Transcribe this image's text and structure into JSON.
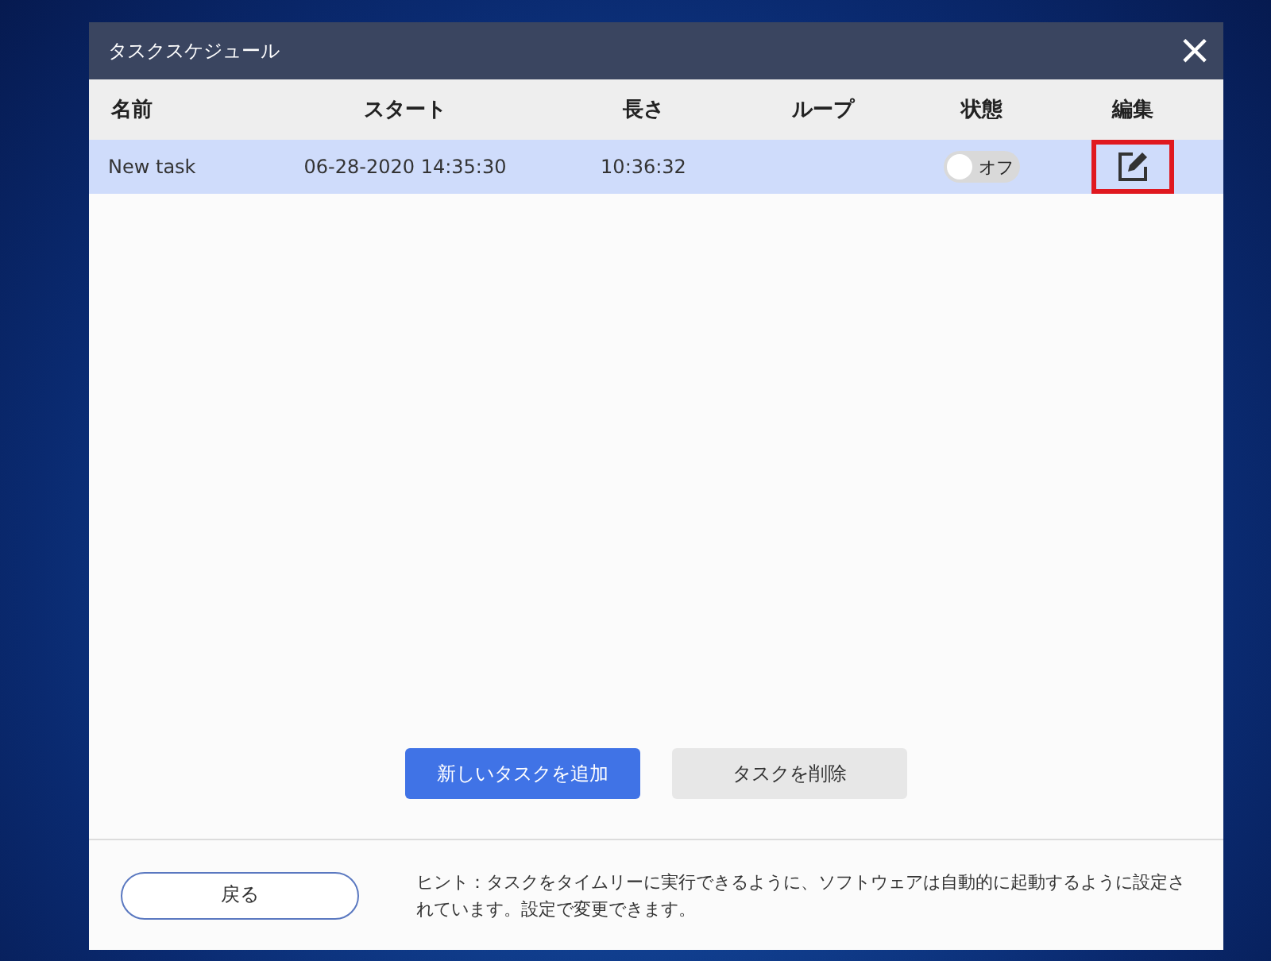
{
  "window": {
    "title": "タスクスケジュール",
    "close_glyph": "×"
  },
  "table": {
    "columns": [
      "名前",
      "スタート",
      "長さ",
      "ループ",
      "状態",
      "編集"
    ],
    "rows": [
      {
        "name": "New task",
        "start": "06-28-2020 14:35:30",
        "length": "10:36:32",
        "selected": true,
        "status": {
          "label": "オフ",
          "on": false
        },
        "edit_highlighted": true
      }
    ]
  },
  "actions": [
    {
      "label": "新しいタスクを追加",
      "kind": "primary"
    },
    {
      "label": "タスクを削除",
      "kind": "secondary"
    }
  ],
  "footer": {
    "back_button": "戻る",
    "hint": "ヒント：タスクをタイムリーに実行できるように、ソフトウェアは自動的に起動するように設定されています。設定で変更できます。"
  }
}
